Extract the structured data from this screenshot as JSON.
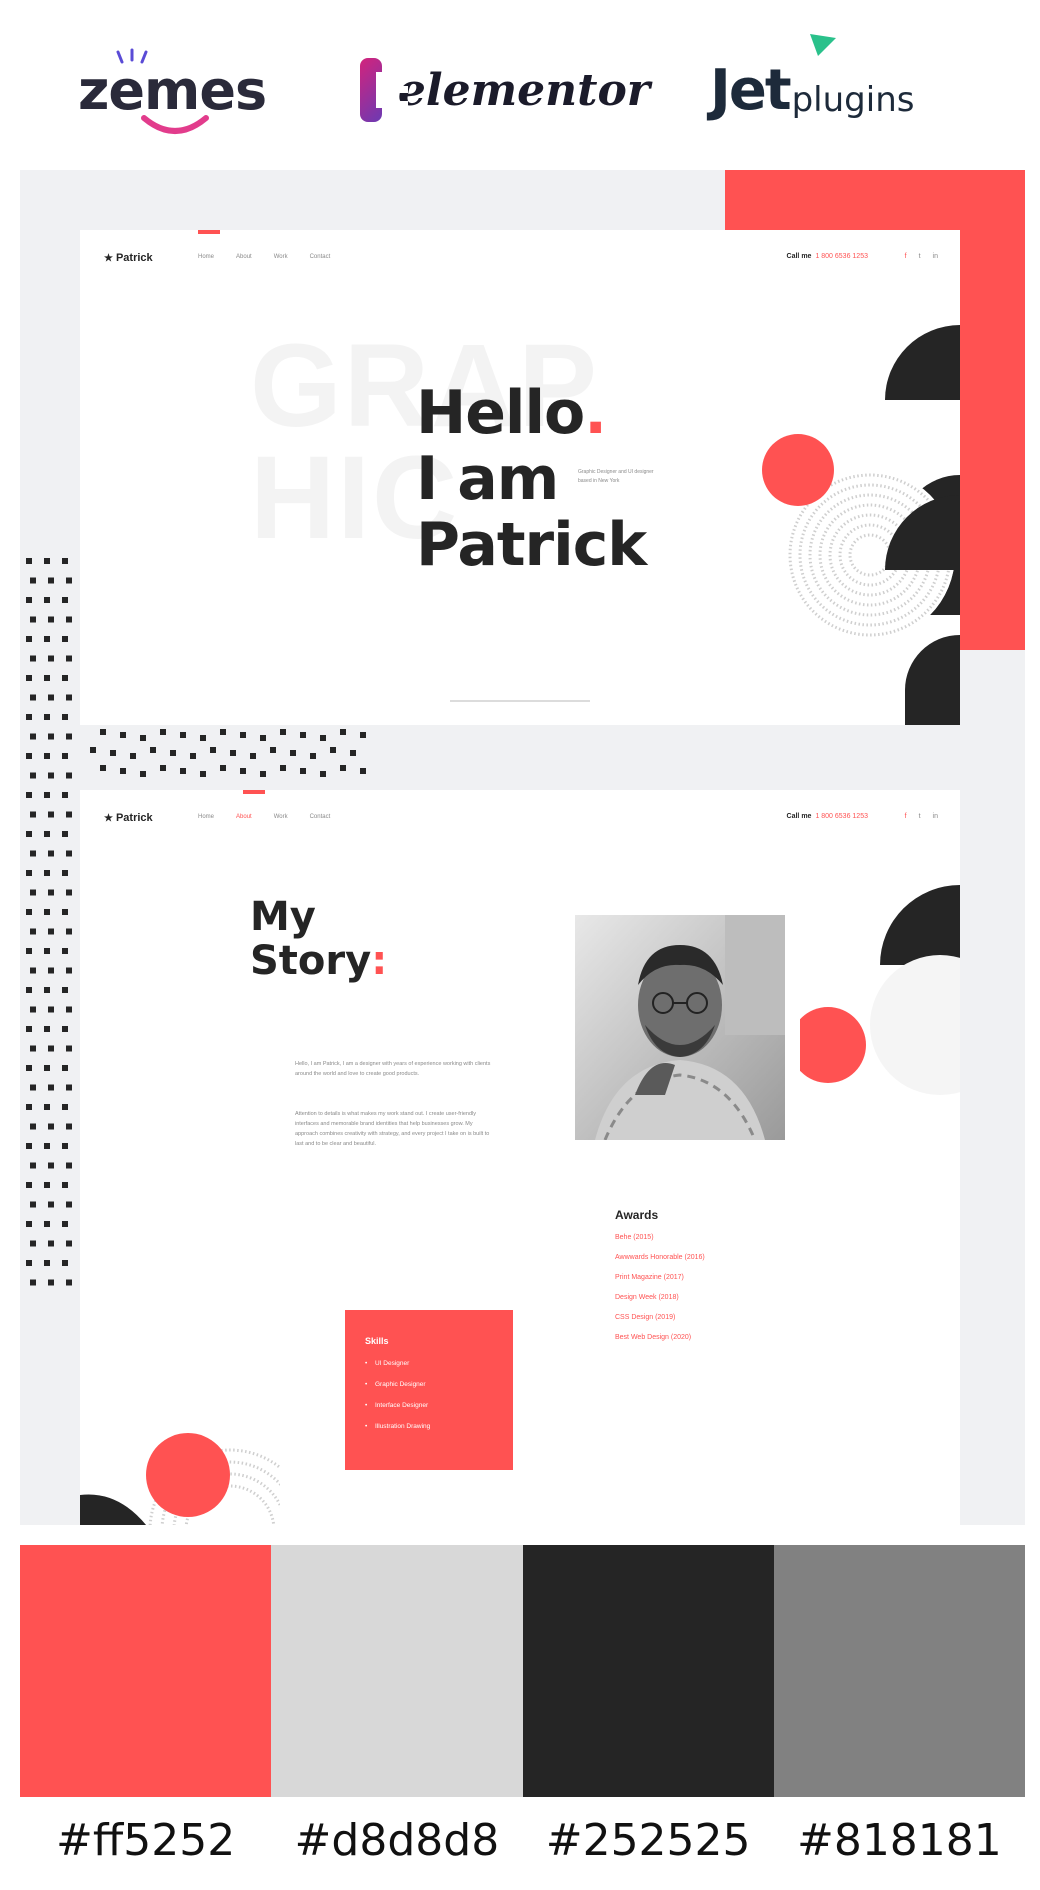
{
  "brands": {
    "zemes": "zemes",
    "elementor": "elementor",
    "jet": "Jet",
    "jet_suffix": "plugins"
  },
  "page1": {
    "nav": {
      "logo": "Patrick",
      "links": [
        "Home",
        "About",
        "Work",
        "Contact"
      ],
      "call_label": "Call me",
      "phone": "1 800 6536 1253",
      "social": [
        "f",
        "t",
        "in"
      ]
    },
    "bg_word": "GRAP HIC",
    "hero_line1": "Hello",
    "hero_dot": ".",
    "hero_line2": "I am",
    "hero_line3": "Patrick",
    "hero_desc": "Graphic Designer and UI designer based in New York"
  },
  "page2": {
    "nav": {
      "logo": "Patrick",
      "links": [
        "Home",
        "About",
        "Work",
        "Contact"
      ],
      "call_label": "Call me",
      "phone": "1 800 6536 1253",
      "social": [
        "f",
        "t",
        "in"
      ]
    },
    "story_line1": "My",
    "story_line2": "Story",
    "story_colon": ":",
    "paragraph1": "Hello, I am Patrick, I am a designer with years of experience working with clients around the world and love to create good products.",
    "paragraph2": "Attention to details is what makes my work stand out. I create user-friendly interfaces and memorable brand identities that help businesses grow. My approach combines creativity with strategy, and every project I take on is built to last and to be clear and beautiful.",
    "awards_title": "Awards",
    "awards": [
      "Behe (2015)",
      "Awwwards Honorable (2016)",
      "Print Magazine (2017)",
      "Design Week (2018)",
      "CSS Design (2019)",
      "Best Web Design (2020)"
    ],
    "skills_title": "Skills",
    "skills": [
      "UI Designer",
      "Graphic Designer",
      "Interface Designer",
      "Illustration Drawing"
    ]
  },
  "palette": [
    {
      "color": "#ff5252",
      "label": "#ff5252"
    },
    {
      "color": "#d8d8d8",
      "label": "#d8d8d8"
    },
    {
      "color": "#252525",
      "label": "#252525"
    },
    {
      "color": "#818181",
      "label": "#818181"
    }
  ],
  "colors": {
    "accent": "#ff5252",
    "light": "#d8d8d8",
    "dark": "#252525",
    "mid": "#818181"
  }
}
